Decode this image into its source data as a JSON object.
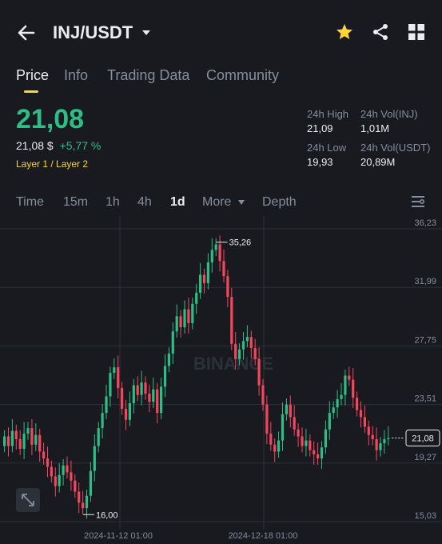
{
  "header": {
    "pair": "INJ/USDT",
    "back_icon": "arrow-left-icon",
    "dropdown_icon": "caret-down-icon",
    "star_icon": "star-icon",
    "share_icon": "share-icon",
    "grid_icon": "grid-icon"
  },
  "tabs": [
    {
      "label": "Price",
      "active": true
    },
    {
      "label": "Info",
      "active": false
    },
    {
      "label": "Trading Data",
      "active": false
    },
    {
      "label": "Community",
      "active": false
    }
  ],
  "price": {
    "last": "21,08",
    "fiat": "21,08 $",
    "change": "+5,77 %",
    "tag": "Layer 1 / Layer 2"
  },
  "stats": {
    "high_label": "24h High",
    "high_value": "21,09",
    "vol_inj_label": "24h Vol(INJ)",
    "vol_inj_value": "1,01M",
    "low_label": "24h Low",
    "low_value": "19,93",
    "vol_usdt_label": "24h Vol(USDT)",
    "vol_usdt_value": "20,89M"
  },
  "timeframes": [
    {
      "label": "Time",
      "active": false
    },
    {
      "label": "15m",
      "active": false
    },
    {
      "label": "1h",
      "active": false
    },
    {
      "label": "4h",
      "active": false
    },
    {
      "label": "1d",
      "active": true
    },
    {
      "label": "More",
      "active": false
    },
    {
      "label": "Depth",
      "active": false
    }
  ],
  "colors": {
    "up": "#2ebd85",
    "down": "#f6465d",
    "accent": "#fcd535",
    "bg": "#181a20",
    "grid": "#2b3139"
  },
  "chart_data": {
    "type": "candlestick",
    "y_ticks": [
      "36,23",
      "31,99",
      "27,75",
      "23,51",
      "19,27",
      "15,03"
    ],
    "x_ticks": [
      "2024-11-12 01:00",
      "2024-12-18 01:00"
    ],
    "ylim": [
      15.03,
      36.23
    ],
    "max_label": "35,26",
    "min_label": "16,00",
    "last_price_label": "21,08",
    "watermark": "BINANCE",
    "closes": [
      21.2,
      20.5,
      21.6,
      21.0,
      20.3,
      21.4,
      21.8,
      20.6,
      21.3,
      20.1,
      19.6,
      19.0,
      18.3,
      17.6,
      18.4,
      19.1,
      18.6,
      18.0,
      17.2,
      16.4,
      16.0,
      16.9,
      18.7,
      20.5,
      21.8,
      22.9,
      24.1,
      25.8,
      26.2,
      24.7,
      23.2,
      22.4,
      23.6,
      24.9,
      24.2,
      25.1,
      24.3,
      23.7,
      24.6,
      22.9,
      24.8,
      26.3,
      27.2,
      28.8,
      29.9,
      29.1,
      30.4,
      29.4,
      30.8,
      31.6,
      32.9,
      32.3,
      33.8,
      34.7,
      35.1,
      33.9,
      32.8,
      31.3,
      27.9,
      26.8,
      27.5,
      28.1,
      28.4,
      27.6,
      26.8,
      24.9,
      23.5,
      21.4,
      20.6,
      20.1,
      20.9,
      22.8,
      23.5,
      22.6,
      21.7,
      21.2,
      20.5,
      20.9,
      20.2,
      19.9,
      19.6,
      20.4,
      21.7,
      22.9,
      23.3,
      23.9,
      24.2,
      25.6,
      25.3,
      24.0,
      23.1,
      22.6,
      21.9,
      21.3,
      21.0,
      20.2,
      20.7,
      21.0,
      21.08
    ],
    "opens": [
      20.5,
      21.2,
      20.5,
      21.6,
      21.0,
      20.3,
      21.4,
      21.8,
      20.6,
      21.3,
      20.1,
      19.6,
      19.0,
      18.3,
      17.6,
      18.4,
      19.1,
      18.6,
      18.0,
      17.2,
      16.4,
      16.0,
      16.9,
      18.7,
      20.5,
      21.8,
      22.9,
      24.1,
      25.8,
      26.2,
      24.7,
      23.2,
      22.4,
      23.6,
      24.9,
      24.2,
      25.1,
      24.3,
      23.7,
      24.6,
      22.9,
      24.8,
      26.3,
      27.2,
      28.8,
      29.9,
      29.1,
      30.4,
      29.4,
      30.8,
      31.6,
      32.9,
      32.3,
      33.8,
      34.7,
      35.1,
      33.9,
      32.8,
      31.3,
      27.9,
      26.8,
      27.5,
      28.1,
      28.4,
      27.6,
      26.8,
      24.9,
      23.5,
      21.4,
      20.6,
      20.1,
      20.9,
      22.8,
      23.5,
      22.6,
      21.7,
      21.2,
      20.5,
      20.9,
      20.2,
      19.9,
      19.6,
      20.4,
      21.7,
      22.9,
      23.3,
      23.9,
      24.2,
      25.6,
      25.3,
      24.0,
      23.1,
      22.6,
      21.9,
      21.3,
      21.0,
      20.2,
      20.7,
      21.0
    ]
  }
}
